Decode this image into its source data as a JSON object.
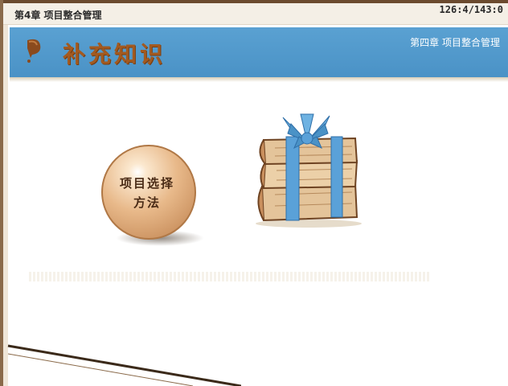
{
  "window": {
    "chapter_title": "第4章 项目整合管理",
    "slide_counter": "126:4/143:0"
  },
  "header": {
    "title": "补充知识",
    "subtitle": "第四章 项目整合管理"
  },
  "content": {
    "sphere_label_line1": "项目选择",
    "sphere_label_line2": "方法"
  },
  "icons": {
    "header": "brown-bullet-icon",
    "books": "gift-books-icon",
    "sphere": "beige-sphere"
  },
  "colors": {
    "header_blue": "#4a92c6",
    "title_brown": "#a35a20",
    "ribbon_blue": "#5aa1d8",
    "book_tan": "#e4c49a"
  }
}
